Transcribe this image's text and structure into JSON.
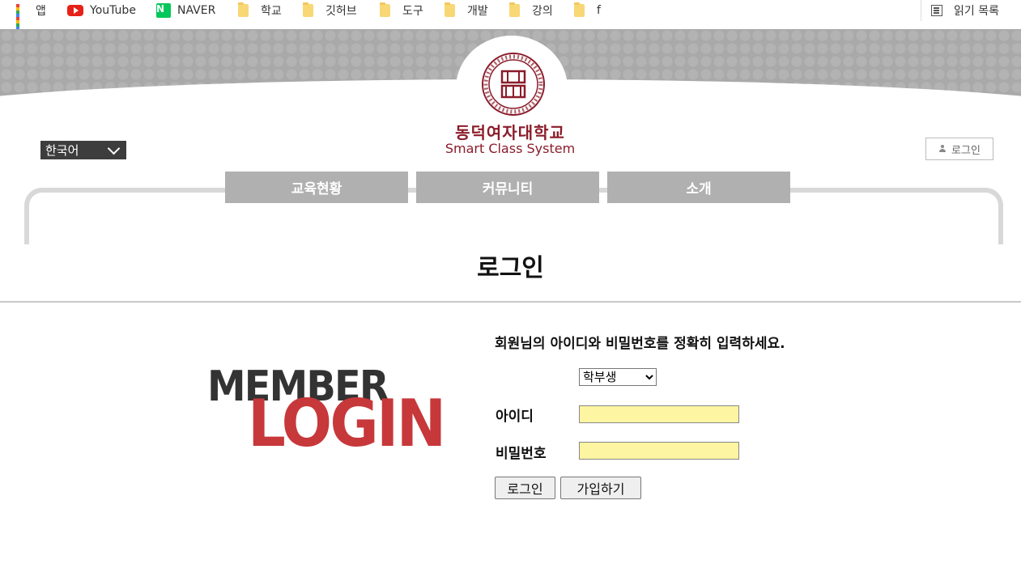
{
  "bookmarks": {
    "items": [
      {
        "label": "앱",
        "icon": "apps-grid-icon"
      },
      {
        "label": "YouTube",
        "icon": "youtube-icon"
      },
      {
        "label": "NAVER",
        "icon": "naver-icon"
      },
      {
        "label": "학교",
        "icon": "folder-icon"
      },
      {
        "label": "깃허브",
        "icon": "folder-icon"
      },
      {
        "label": "도구",
        "icon": "folder-icon"
      },
      {
        "label": "개발",
        "icon": "folder-icon"
      },
      {
        "label": "강의",
        "icon": "folder-icon"
      },
      {
        "label": "f",
        "icon": "folder-icon"
      }
    ],
    "reading_list": "읽기 목록"
  },
  "header": {
    "university_name": "동덕여자대학교",
    "system_name": "Smart Class System",
    "language": "한국어",
    "login_link": "로그인",
    "nav": [
      {
        "label": "교육현황"
      },
      {
        "label": "커뮤니티"
      },
      {
        "label": "소개"
      }
    ],
    "colors": {
      "brand": "#8b1c2a",
      "nav_bg": "#b0b0b0",
      "header_bg": "#a9a9a9"
    }
  },
  "page": {
    "title": "로그인"
  },
  "graphic": {
    "member": "MEMBER",
    "login": "LOGIN",
    "colors": {
      "member": "#333333",
      "login": "#c7383b"
    }
  },
  "form": {
    "instruction": "회원님의 아이디와 비밀번호를 정확히 입력하세요.",
    "role_selected": "학부생",
    "id_label": "아이디",
    "id_value": "",
    "password_label": "비밀번호",
    "password_value": "",
    "login_button": "로그인",
    "signup_button": "가입하기",
    "field_color": "#fdf5a1"
  }
}
